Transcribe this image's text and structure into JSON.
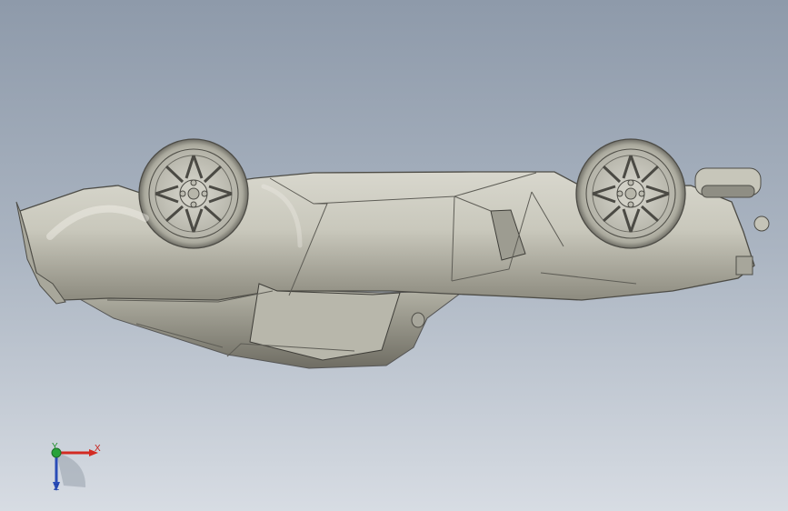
{
  "viewport": {
    "background_top": "#8e9aaa",
    "background_bottom": "#d7dce3",
    "model_color": "#c8c7bb"
  },
  "triad": {
    "x_label": "X",
    "y_label": "Y",
    "z_label": "Z",
    "x_color": "#c8201a",
    "y_color": "#1f8f2b",
    "z_color": "#1c3fa8"
  }
}
